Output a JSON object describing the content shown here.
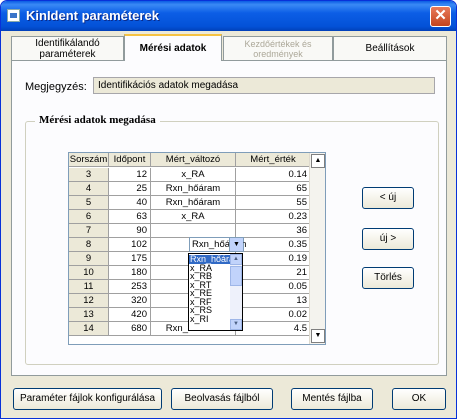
{
  "window": {
    "title": "KinIdent paraméterek"
  },
  "tabs": [
    {
      "label": "Identifikálandó paraméterek"
    },
    {
      "label": "Mérési adatok"
    },
    {
      "label_line1": "Kezdőértékek és",
      "label_line2": "oredmények"
    },
    {
      "label": "Beállítások"
    }
  ],
  "note": {
    "label": "Megjegyzés:",
    "value": "Identifikációs adatok megadása"
  },
  "group": {
    "title": "Mérési adatok megadása"
  },
  "table": {
    "headers": [
      "Sorszám",
      "Időpont",
      "Mért_változó",
      "Mért_érték"
    ],
    "rows": [
      {
        "sorszam": "3",
        "idopont": "12",
        "valtozo": "x_RA",
        "ertek": "0.14"
      },
      {
        "sorszam": "4",
        "idopont": "25",
        "valtozo": "Rxn_hőáram",
        "ertek": "65"
      },
      {
        "sorszam": "5",
        "idopont": "40",
        "valtozo": "Rxn_hőáram",
        "ertek": "55"
      },
      {
        "sorszam": "6",
        "idopont": "63",
        "valtozo": "x_RA",
        "ertek": "0.23"
      },
      {
        "sorszam": "7",
        "idopont": "90",
        "valtozo": "",
        "ertek": "36"
      },
      {
        "sorszam": "8",
        "idopont": "102",
        "valtozo": "",
        "ertek": "0.35"
      },
      {
        "sorszam": "9",
        "idopont": "175",
        "valtozo": "",
        "ertek": "0.19"
      },
      {
        "sorszam": "10",
        "idopont": "180",
        "valtozo": "",
        "ertek": "21"
      },
      {
        "sorszam": "11",
        "idopont": "253",
        "valtozo": "",
        "ertek": "0.05"
      },
      {
        "sorszam": "12",
        "idopont": "320",
        "valtozo": "",
        "ertek": "13"
      },
      {
        "sorszam": "13",
        "idopont": "420",
        "valtozo": "",
        "ertek": "0.02"
      },
      {
        "sorszam": "14",
        "idopont": "680",
        "valtozo": "Rxn_hőáram",
        "ertek": "4.5"
      }
    ],
    "editor_value": "Rxn_hőáram"
  },
  "dropdown": {
    "options": [
      "Rxn_hőáram",
      "x_RA",
      "x_RB",
      "x_RT",
      "x_RE",
      "x_RF",
      "x_RS",
      "x_RI"
    ],
    "selected": "Rxn_hőáram"
  },
  "side_buttons": {
    "prev": "< új",
    "next": "új >",
    "delete": "Törlés"
  },
  "bottom_buttons": {
    "config": "Paraméter fájlok konfigurálása",
    "load": "Beolvasás fájlból",
    "save": "Mentés fájlba",
    "ok": "OK"
  },
  "colors": {
    "titlebar": "#0351d7",
    "selection": "#316ac5",
    "tab_accent": "#f5c242"
  }
}
